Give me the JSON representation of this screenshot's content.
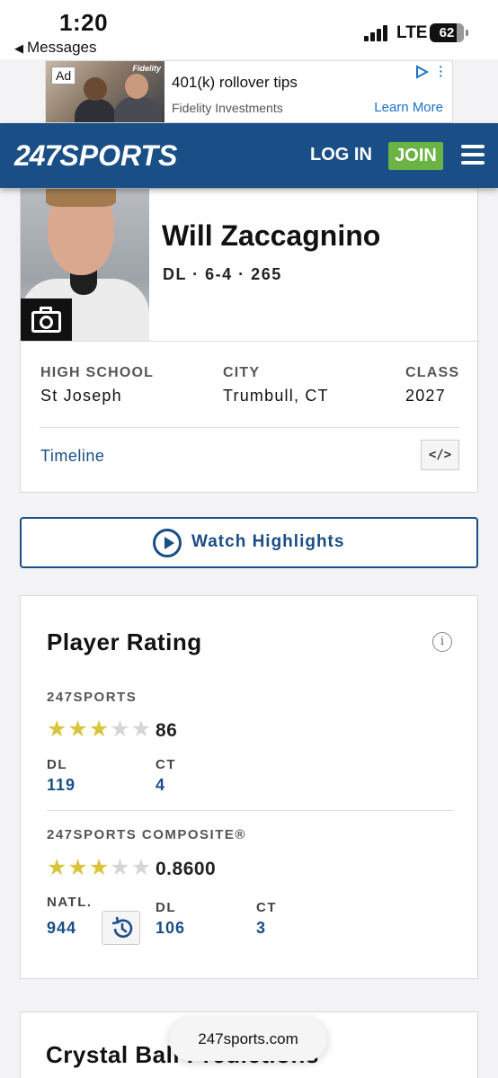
{
  "status_bar": {
    "time": "1:20",
    "back_label": "Messages",
    "network": "LTE",
    "battery": "62"
  },
  "ad": {
    "badge": "Ad",
    "brand": "Fidelity",
    "title": "401(k) rollover tips",
    "advertiser": "Fidelity Investments",
    "cta": "Learn More"
  },
  "header": {
    "logo_num": "247",
    "logo_word": "SPORTS",
    "login": "LOG IN",
    "join": "JOIN",
    "colors": {
      "brand": "#1a4e86",
      "join": "#6ab344"
    }
  },
  "profile": {
    "name": "Will Zaccagnino",
    "position_height_weight": "DL · 6-4 · 265",
    "high_school_label": "HIGH SCHOOL",
    "high_school": "St Joseph",
    "city_label": "CITY",
    "city": "Trumbull, CT",
    "class_label": "CLASS",
    "class_year": "2027",
    "timeline": "Timeline",
    "embed": "</>",
    "icons": [
      "camera-icon",
      "embed-icon"
    ]
  },
  "watch": {
    "label": "Watch Highlights",
    "icon": "play-circle-icon"
  },
  "rating": {
    "title": "Player Rating",
    "info": "i",
    "sports247": {
      "label": "247SPORTS",
      "stars": 3,
      "score": "86",
      "pos_label": "DL",
      "pos_rank": "119",
      "state_label": "CT",
      "state_rank": "4"
    },
    "composite": {
      "label": "247SPORTS COMPOSITE®",
      "stars": 3,
      "score": "0.8600",
      "natl_label": "NATL.",
      "natl_rank": "944",
      "pos_label": "DL",
      "pos_rank": "106",
      "state_label": "CT",
      "state_rank": "3"
    },
    "colors": {
      "star_on": "#d8c53a",
      "star_off": "#d5d5d5",
      "rank": "#1a4e86"
    }
  },
  "crystal_ball": {
    "title": "Crystal Ball Predictions"
  },
  "browser": {
    "url": "247sports.com"
  }
}
